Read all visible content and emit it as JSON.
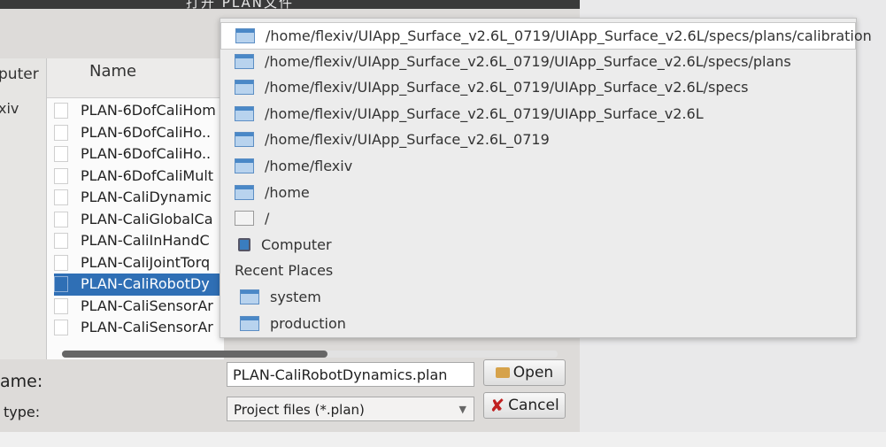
{
  "window": {
    "title": "打开 PLAN文件"
  },
  "places": {
    "header": "puter",
    "item": "xiv"
  },
  "filelist": {
    "column_name": "Name",
    "rows": [
      "PLAN-6DofCaliHom",
      "PLAN-6DofCaliHo..",
      "PLAN-6DofCaliHo..",
      "PLAN-6DofCaliMult",
      "PLAN-CaliDynamic",
      "PLAN-CaliGlobalCa",
      "PLAN-CaliInHandC",
      "PLAN-CaliJointTorq",
      "PLAN-CaliRobotDy",
      "PLAN-CaliSensorAr",
      "PLAN-CaliSensorAr"
    ],
    "selected_index": 8
  },
  "form": {
    "name_label": "ame:",
    "type_label": "type:",
    "name_value": "PLAN-CaliRobotDynamics.plan",
    "type_value": "Project files (*.plan)",
    "open_label": "Open",
    "cancel_label": "Cancel"
  },
  "popup": {
    "paths": [
      "/home/flexiv/UIApp_Surface_v2.6L_0719/UIApp_Surface_v2.6L/specs/plans/calibration",
      "/home/flexiv/UIApp_Surface_v2.6L_0719/UIApp_Surface_v2.6L/specs/plans",
      "/home/flexiv/UIApp_Surface_v2.6L_0719/UIApp_Surface_v2.6L/specs",
      "/home/flexiv/UIApp_Surface_v2.6L_0719/UIApp_Surface_v2.6L",
      "/home/flexiv/UIApp_Surface_v2.6L_0719",
      "/home/flexiv",
      "/home",
      "/"
    ],
    "computer": "Computer",
    "recent_header": "Recent Places",
    "recent": [
      "system",
      "production"
    ]
  }
}
